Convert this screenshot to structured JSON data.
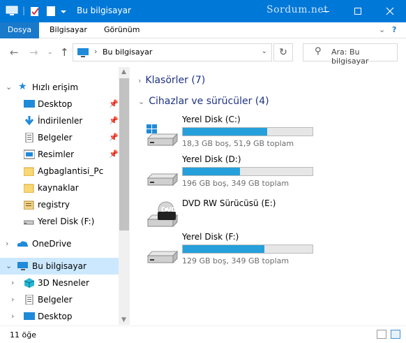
{
  "window": {
    "title": "Bu bilgisayar",
    "watermark": "Sordum.net",
    "controls": [
      "minimize",
      "maximize",
      "close"
    ]
  },
  "ribbon": {
    "tabs": [
      "Dosya",
      "Bilgisayar",
      "Görünüm"
    ]
  },
  "address": {
    "path": "Bu bilgisayar",
    "search_placeholder": "Ara: Bu bilgisayar"
  },
  "nav": {
    "quick_access": "Hızlı erişim",
    "quick_items": [
      {
        "label": "Desktop",
        "pinned": true,
        "icon": "desktop-icon"
      },
      {
        "label": "İndirilenler",
        "pinned": true,
        "icon": "download-icon"
      },
      {
        "label": "Belgeler",
        "pinned": true,
        "icon": "documents-icon"
      },
      {
        "label": "Resimler",
        "pinned": true,
        "icon": "pictures-icon"
      },
      {
        "label": "Agbaglantisi_Pc",
        "pinned": false,
        "icon": "folder-icon"
      },
      {
        "label": "kaynaklar",
        "pinned": false,
        "icon": "folder-icon"
      },
      {
        "label": "registry",
        "pinned": false,
        "icon": "registry-folder-icon"
      },
      {
        "label": "Yerel Disk (F:)",
        "pinned": false,
        "icon": "drive-icon"
      }
    ],
    "onedrive": "OneDrive",
    "this_pc": "Bu bilgisayar",
    "pc_children": [
      {
        "label": "3D Nesneler",
        "icon": "3d-objects-icon"
      },
      {
        "label": "Belgeler",
        "icon": "documents-icon"
      },
      {
        "label": "Desktop",
        "icon": "desktop-icon"
      }
    ]
  },
  "content": {
    "folders_group": "Klasörler (7)",
    "devices_group": "Cihazlar ve sürücüler (4)",
    "drives": [
      {
        "name": "Yerel Disk (C:)",
        "info": "18,3 GB boş, 51,9 GB toplam",
        "used_fraction": 0.65,
        "type": "windows-drive"
      },
      {
        "name": "Yerel Disk (D:)",
        "info": "196 GB boş, 349 GB toplam",
        "used_fraction": 0.44,
        "type": "drive"
      },
      {
        "name": "DVD RW Sürücüsü (E:)",
        "info": "",
        "used_fraction": null,
        "type": "dvd",
        "badge": "DVD"
      },
      {
        "name": "Yerel Disk (F:)",
        "info": "129 GB boş, 349 GB toplam",
        "used_fraction": 0.63,
        "type": "drive"
      }
    ]
  },
  "status": {
    "item_count": "11 öğe"
  },
  "colors": {
    "titlebar": "#0078d7",
    "file_tab": "#1979ca",
    "selection": "#cce8ff",
    "usage_bar": "#26a0da",
    "group_header": "#1e3287"
  }
}
